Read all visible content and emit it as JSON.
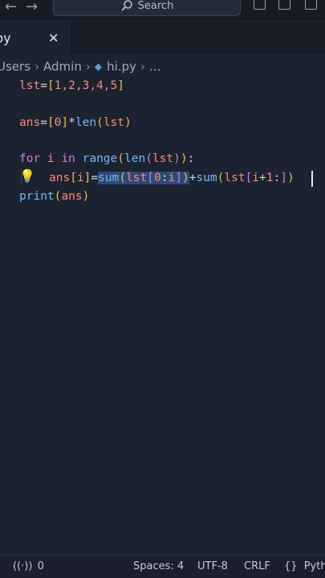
{
  "titlebar": {
    "search_label": "Search",
    "back_icon": "arrow-left-icon",
    "forward_icon": "arrow-right-icon"
  },
  "tab": {
    "label": "py",
    "close": "✕"
  },
  "breadcrumb": {
    "items": [
      "Users",
      "Admin",
      "hi.py",
      "..."
    ]
  },
  "code": {
    "line1": {
      "a": "lst",
      "b": "=",
      "c": "[",
      "d": "1,2,3,4,5",
      "e": "]"
    },
    "line3": {
      "a": "ans",
      "b": "=",
      "c": "[",
      "d": "0",
      "e": "]",
      "f": "*",
      "g": "len",
      "h": "(",
      "i": "lst",
      "j": ")"
    },
    "line5": {
      "a": "for",
      "b": " i ",
      "c": "in",
      "d": " ",
      "e": "range",
      "f": "(",
      "g": "len",
      "h": "(",
      "i": "lst",
      "j": ")",
      "k": ")",
      "l": ":"
    },
    "line6": {
      "a": "ans",
      "b": "[",
      "c": "i",
      "d": "]",
      "e": "=",
      "f": "sum",
      "g": "(",
      "h": "lst",
      "i": "[",
      "j": "0",
      "k": ":",
      "l": "i",
      "m": "]",
      "n": ")",
      "o": "+",
      "p": "sum",
      "q": "(",
      "r": "lst",
      "s": "[",
      "t": "i",
      "u": "+",
      "v": "1",
      "w": ":",
      "x": "]",
      "y": ")"
    },
    "line7": {
      "a": "print",
      "b": "(",
      "c": "ans",
      "d": ")"
    }
  },
  "statusbar": {
    "remote": "0",
    "spaces": "Spaces: 4",
    "encoding": "UTF-8",
    "eol": "CRLF",
    "language": "Pyth"
  },
  "colors": {
    "keyword": "#e07ad8",
    "function": "#74b8ff",
    "variable": "#ff8a7a",
    "selection": "#2c4a78",
    "background": "#1b2230"
  }
}
